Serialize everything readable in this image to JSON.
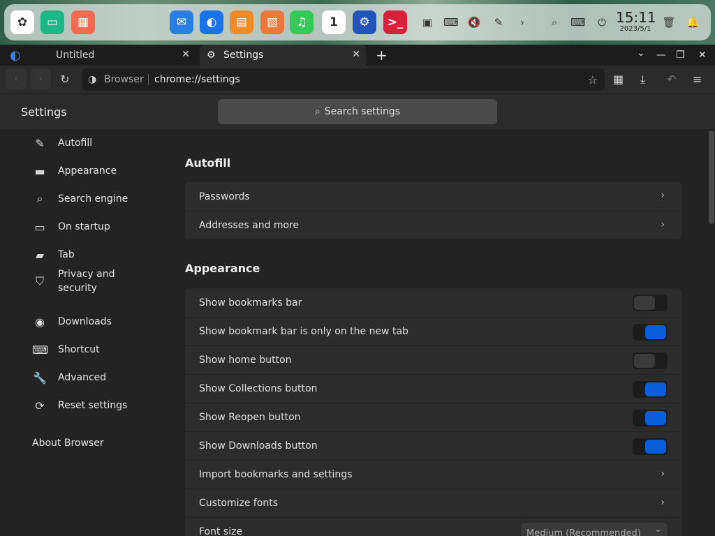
{
  "dock": {
    "apps": [
      {
        "name": "launcher-icon",
        "glyph": "✿",
        "color": "#ffffff"
      },
      {
        "name": "file-manager-icon",
        "glyph": "▭",
        "color": "#1db786"
      },
      {
        "name": "app-store-icon",
        "glyph": "▦",
        "color": "#f26a4f"
      },
      {
        "name": "mail-icon",
        "glyph": "✉",
        "color": "#2a7de1"
      },
      {
        "name": "browser-icon",
        "glyph": "◐",
        "color": "#1a73e8"
      },
      {
        "name": "store-icon",
        "glyph": "▤",
        "color": "#f08a24"
      },
      {
        "name": "photos-icon",
        "glyph": "▧",
        "color": "#e8793a"
      },
      {
        "name": "music-icon",
        "glyph": "♫",
        "color": "#36c95a"
      },
      {
        "name": "calendar-icon",
        "glyph": "1",
        "color": "#ffffff"
      },
      {
        "name": "settings-icon",
        "glyph": "⚙",
        "color": "#2355b8"
      },
      {
        "name": "terminal-icon",
        "glyph": ">_",
        "color": "#d8203a"
      }
    ],
    "tray": [
      {
        "name": "screenshot-icon",
        "glyph": "▣"
      },
      {
        "name": "keyboard-layout-icon",
        "glyph": "⌨"
      },
      {
        "name": "volume-mute-icon",
        "glyph": "🔇"
      },
      {
        "name": "pen-icon",
        "glyph": "✎"
      },
      {
        "name": "chevron-right-icon",
        "glyph": "›"
      },
      {
        "name": "search-icon",
        "glyph": "⌕"
      },
      {
        "name": "keyboard-icon",
        "glyph": "⌨"
      },
      {
        "name": "power-icon",
        "glyph": "⏻"
      }
    ],
    "clock_time": "15:11",
    "clock_date": "2023/5/1",
    "trash_glyph": "🗑",
    "bell_glyph": "🔔"
  },
  "tabs": {
    "tab1_label": "Untitled",
    "tab2_label": "Settings",
    "close_glyph": "✕",
    "new_tab_glyph": "+",
    "browser_glyph": "◐",
    "gear_glyph": "⚙"
  },
  "window": {
    "dropdown_glyph": "⌄",
    "minimize_glyph": "—",
    "restore_glyph": "❐",
    "close_glyph": "✕"
  },
  "address": {
    "back_glyph": "‹",
    "forward_glyph": "›",
    "reload_glyph": "↻",
    "site_glyph": "◑",
    "source_label": "Browser",
    "url": "chrome://settings",
    "star_glyph": "☆",
    "collections_glyph": "▦",
    "download_glyph": "⤓",
    "reopen_glyph": "↶",
    "menu_glyph": "≡"
  },
  "header": {
    "title": "Settings",
    "search_glyph": "⌕",
    "search_placeholder": "Search settings"
  },
  "sidebar": {
    "items": [
      {
        "name": "sidebar-item-autofill",
        "icon_name": "pencil-icon",
        "glyph": "✎",
        "label": "Autofill"
      },
      {
        "name": "sidebar-item-appearance",
        "icon_name": "monitor-icon",
        "glyph": "▬",
        "label": "Appearance"
      },
      {
        "name": "sidebar-item-search-engine",
        "icon_name": "search-icon",
        "glyph": "⌕",
        "label": "Search engine"
      },
      {
        "name": "sidebar-item-on-startup",
        "icon_name": "window-icon",
        "glyph": "▭",
        "label": "On startup"
      },
      {
        "name": "sidebar-item-tab",
        "icon_name": "folder-icon",
        "glyph": "▰",
        "label": "Tab"
      },
      {
        "name": "sidebar-item-privacy",
        "icon_name": "shield-icon",
        "glyph": "⛉",
        "label": "Privacy and security"
      },
      {
        "name": "sidebar-item-downloads",
        "icon_name": "download-icon",
        "glyph": "◉",
        "label": "Downloads"
      },
      {
        "name": "sidebar-item-shortcut",
        "icon_name": "keyboard-icon",
        "glyph": "⌨",
        "label": "Shortcut"
      },
      {
        "name": "sidebar-item-advanced",
        "icon_name": "wrench-icon",
        "glyph": "🔧",
        "label": "Advanced"
      },
      {
        "name": "sidebar-item-reset",
        "icon_name": "reset-icon",
        "glyph": "⟳",
        "label": "Reset settings"
      }
    ],
    "about_label": "About Browser"
  },
  "main": {
    "autofill_heading": "Autofill",
    "autofill_rows": [
      {
        "name": "passwords-row",
        "label": "Passwords"
      },
      {
        "name": "addresses-row",
        "label": "Addresses and more"
      }
    ],
    "appearance_heading": "Appearance",
    "appearance_rows": [
      {
        "name": "show-bookmarks-bar-row",
        "label": "Show bookmarks bar",
        "control": "toggle",
        "on": false
      },
      {
        "name": "bookmark-bar-new-tab-row",
        "label": "Show bookmark bar is only on the new tab",
        "control": "toggle",
        "on": true
      },
      {
        "name": "show-home-button-row",
        "label": "Show home button",
        "control": "toggle",
        "on": false
      },
      {
        "name": "show-collections-button-row",
        "label": "Show Collections button",
        "control": "toggle",
        "on": true
      },
      {
        "name": "show-reopen-button-row",
        "label": "Show Reopen button",
        "control": "toggle",
        "on": true
      },
      {
        "name": "show-downloads-button-row",
        "label": "Show Downloads button",
        "control": "toggle",
        "on": true
      },
      {
        "name": "import-bookmarks-row",
        "label": "Import bookmarks and settings",
        "control": "chevron"
      },
      {
        "name": "customize-fonts-row",
        "label": "Customize fonts",
        "control": "chevron"
      },
      {
        "name": "font-size-row",
        "label": "Font size",
        "control": "select",
        "value": "Medium (Recommended)"
      }
    ],
    "chevron_glyph": "›",
    "select_caret_glyph": "⌄"
  }
}
